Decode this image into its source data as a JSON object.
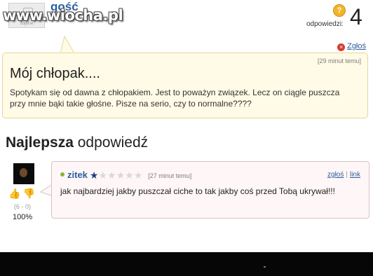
{
  "asker": {
    "name": "gość",
    "avatar_caption": "zdjęcie"
  },
  "watermark": "www.wiocha.pl",
  "answers": {
    "label": "odpowiedzi:",
    "count": "4",
    "icon": "question-bubble-icon"
  },
  "report_label": "Zgłoś",
  "question": {
    "time": "[29 minut temu]",
    "title": "Mój chłopak....",
    "body": "Spotykam się od dawna z chłopakiem. Jest to poważyn związek. Lecz on ciągle puszcza przy mnie bąki takie głośne. Pisze na serio, czy to normalne????"
  },
  "best_answer": {
    "heading_bold": "Najlepsza",
    "heading_rest": " odpowiedź",
    "user": "zitek",
    "stars_filled": 1,
    "stars_total": 6,
    "time": "[27 minut temu]",
    "links": {
      "report": "zgłoś",
      "separator": "|",
      "link": "link"
    },
    "votes": "(6 - 0)",
    "percent": "100%",
    "body": "jak najbardziej jakby puszczał ciche to tak jakby coś przed Tobą ukrywał!!!"
  },
  "colors": {
    "link": "#2c5d9e",
    "question_bg": "#fffbe6",
    "answer_bg": "#fff7f7",
    "star": "#1f3f8a"
  }
}
